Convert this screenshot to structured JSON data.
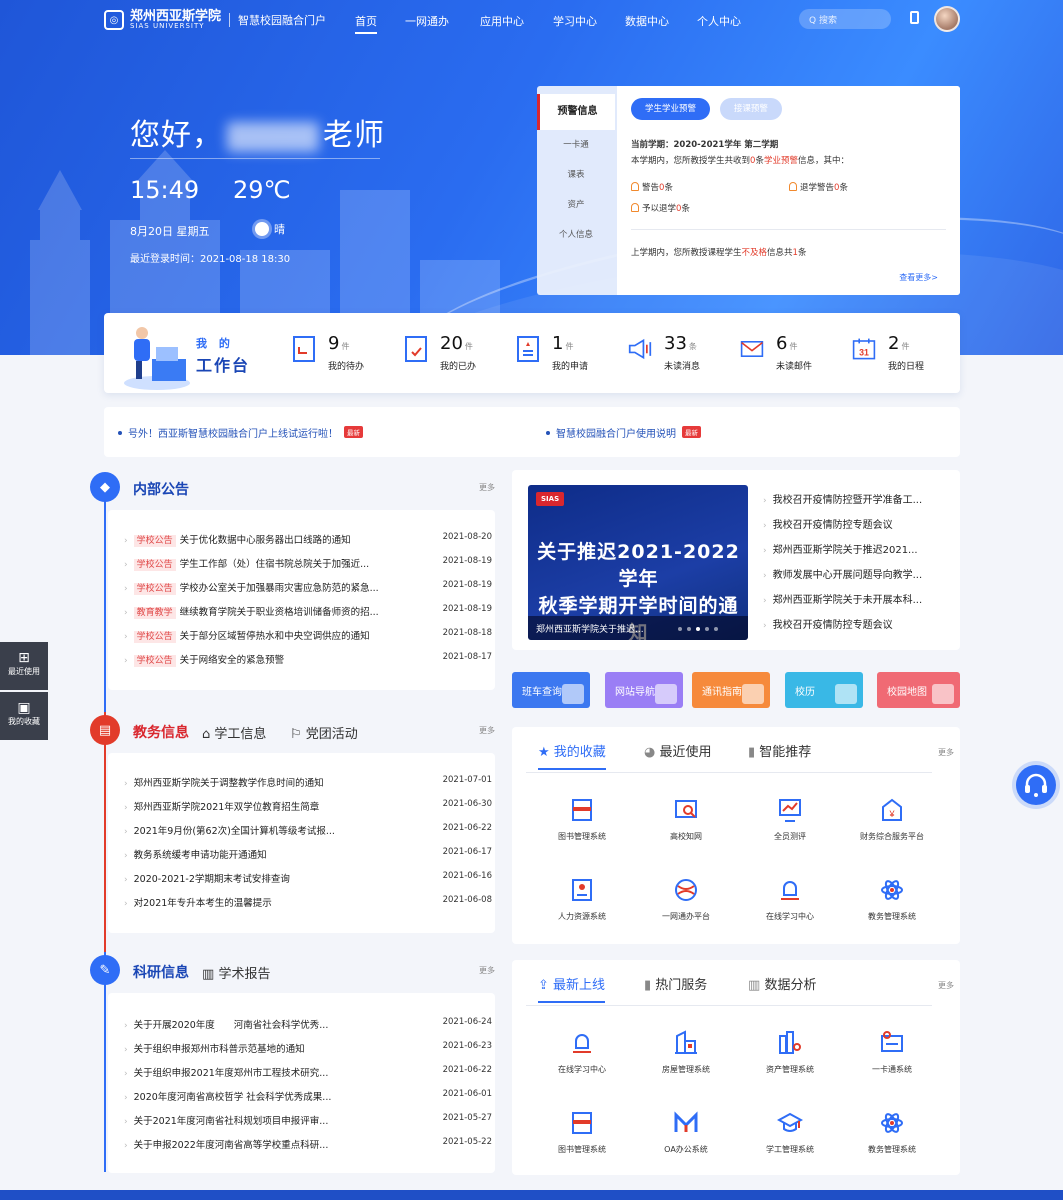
{
  "header": {
    "logo_cn": "郑州西亚斯学院",
    "logo_en": "SIAS UNIVERSITY",
    "portal_name": "智慧校园融合门户",
    "nav": [
      "首页",
      "一网通办",
      "应用中心",
      "学习中心",
      "数据中心",
      "个人中心"
    ],
    "search_placeholder": "Q 搜索"
  },
  "hero": {
    "greeting_prefix": "您好，",
    "greeting_suffix": "老师",
    "time": "15:49",
    "temperature": "29℃",
    "date": "8月20日 星期五",
    "weather": "晴",
    "last_login": "最近登录时间：2021-08-18 18:30"
  },
  "warning": {
    "side_tabs": [
      "预警信息",
      "一卡通",
      "课表",
      "资产",
      "个人信息"
    ],
    "pills": [
      "学生学业预警",
      "接课预警"
    ],
    "term_label": "当前学期：2020-2021学年 第二学期",
    "summary_a": "本学期内，您所教授学生共收到",
    "summary_count": "0",
    "summary_b": "条",
    "summary_kw": "学业预警",
    "summary_c": "信息，其中：",
    "items": [
      {
        "label": "警告",
        "count": "0",
        "unit": "条"
      },
      {
        "label": "退学警告",
        "count": "0",
        "unit": "条"
      },
      {
        "label": "予以退学",
        "count": "0",
        "unit": "条"
      }
    ],
    "last_term_a": "上学期内，您所教授课程学生",
    "last_term_kw": "不及格",
    "last_term_b": "信息共",
    "last_term_count": "1",
    "last_term_c": "条",
    "more": "查看更多>"
  },
  "workbench": {
    "label1": "我 的",
    "label2": "工作台",
    "items": [
      {
        "num": "9",
        "unit": "件",
        "label": "我的待办"
      },
      {
        "num": "20",
        "unit": "件",
        "label": "我的已办"
      },
      {
        "num": "1",
        "unit": "件",
        "label": "我的申请"
      },
      {
        "num": "33",
        "unit": "条",
        "label": "未读消息"
      },
      {
        "num": "6",
        "unit": "件",
        "label": "未读邮件"
      },
      {
        "num": "2",
        "unit": "件",
        "label": "我的日程"
      }
    ],
    "calendar_day": "31"
  },
  "ticker": [
    {
      "text": "号外！西亚斯智慧校园融合门户上线试运行啦！",
      "tag": "最新"
    },
    {
      "text": "智慧校园融合门户使用说明",
      "tag": "最新"
    }
  ],
  "notices": {
    "title": "内部公告",
    "more": "更多",
    "items": [
      {
        "tag": "学校公告",
        "title": "关于优化数据中心服务器出口线路的通知",
        "date": "2021-08-20"
      },
      {
        "tag": "学校公告",
        "title": "学生工作部（处）住宿书院总院关于加强近...",
        "date": "2021-08-19"
      },
      {
        "tag": "学校公告",
        "title": "学校办公室关于加强暴雨灾害应急防范的紧急...",
        "date": "2021-08-19"
      },
      {
        "tag": "教育教学",
        "title": "继续教育学院关于职业资格培训储备师资的招...",
        "date": "2021-08-19"
      },
      {
        "tag": "学校公告",
        "title": "关于部分区域暂停热水和中央空调供应的通知",
        "date": "2021-08-18"
      },
      {
        "tag": "学校公告",
        "title": "关于网络安全的紧急预警",
        "date": "2021-08-17"
      }
    ]
  },
  "academic": {
    "title": "教务信息",
    "tabs": [
      "学工信息",
      "党团活动"
    ],
    "more": "更多",
    "items": [
      {
        "title": "郑州西亚斯学院关于调整教学作息时间的通知",
        "date": "2021-07-01"
      },
      {
        "title": "郑州西亚斯学院2021年双学位教育招生简章",
        "date": "2021-06-30"
      },
      {
        "title": "2021年9月份(第62次)全国计算机等级考试报...",
        "date": "2021-06-22"
      },
      {
        "title": "教务系统缓考申请功能开通通知",
        "date": "2021-06-17"
      },
      {
        "title": "2020-2021-2学期期末考试安排查询",
        "date": "2021-06-16"
      },
      {
        "title": "对2021年专升本考生的温馨提示",
        "date": "2021-06-08"
      }
    ]
  },
  "research": {
    "title": "科研信息",
    "tabs": [
      "学术报告"
    ],
    "more": "更多",
    "items": [
      {
        "title": "关于开展2020年度　　河南省社会科学优秀...",
        "date": "2021-06-24"
      },
      {
        "title": "关于组织申报郑州市科普示范基地的通知",
        "date": "2021-06-23"
      },
      {
        "title": "关于组织申报2021年度郑州市工程技术研究...",
        "date": "2021-06-22"
      },
      {
        "title": "2020年度河南省高校哲学 社会科学优秀成果...",
        "date": "2021-06-01"
      },
      {
        "title": "关于2021年度河南省社科规划项目申报评审...",
        "date": "2021-05-27"
      },
      {
        "title": "关于申报2022年度河南省高等学校重点科研...",
        "date": "2021-05-22"
      }
    ]
  },
  "banner": {
    "badge": "SIAS",
    "headline1": "关于推迟2021-2022学年",
    "headline2": "秋季学期开学时间的通知",
    "caption": "郑州西亚斯学院关于推迟...",
    "side_news": [
      "我校召开疫情防控暨开学准备工...",
      "我校召开疫情防控专题会议",
      "郑州西亚斯学院关于推迟2021...",
      "教师发展中心开展问题导向教学...",
      "郑州西亚斯学院关于未开展本科...",
      "我校召开疫情防控专题会议"
    ]
  },
  "quick_tiles": [
    {
      "label": "班车查询",
      "color": "#3c78f0"
    },
    {
      "label": "网站导航",
      "color": "#9a7ef5"
    },
    {
      "label": "通讯指南",
      "color": "#f68a3c"
    },
    {
      "label": "校历",
      "color": "#39b8e6"
    },
    {
      "label": "校园地图",
      "color": "#f06a74"
    }
  ],
  "favorites": {
    "tabs": [
      "我的收藏",
      "最近使用",
      "智能推荐"
    ],
    "more": "更多",
    "apps": [
      {
        "name": "图书管理系统",
        "icon": "book-icon"
      },
      {
        "name": "高校知网",
        "icon": "search-chart-icon"
      },
      {
        "name": "全员测评",
        "icon": "chart-board-icon"
      },
      {
        "name": "财务综合服务平台",
        "icon": "finance-icon"
      },
      {
        "name": "人力资源系统",
        "icon": "hr-icon"
      },
      {
        "name": "一网通办平台",
        "icon": "globe-icon"
      },
      {
        "name": "在线学习中心",
        "icon": "bell-icon"
      },
      {
        "name": "教务管理系统",
        "icon": "atom-icon"
      }
    ]
  },
  "latest": {
    "tabs": [
      "最新上线",
      "热门服务",
      "数据分析"
    ],
    "more": "更多",
    "apps": [
      {
        "name": "在线学习中心",
        "icon": "bell-icon"
      },
      {
        "name": "房屋管理系统",
        "icon": "building-icon"
      },
      {
        "name": "资产管理系统",
        "icon": "asset-icon"
      },
      {
        "name": "一卡通系统",
        "icon": "card-icon"
      },
      {
        "name": "图书管理系统",
        "icon": "book-icon"
      },
      {
        "name": "OA办公系统",
        "icon": "m-icon"
      },
      {
        "name": "学工管理系统",
        "icon": "grad-cap-icon"
      },
      {
        "name": "教务管理系统",
        "icon": "atom-icon"
      }
    ]
  },
  "floaters": [
    "最近使用",
    "我的收藏"
  ],
  "colors": {
    "primary": "#2f6df6",
    "red": "#e23b2a",
    "orange": "#f1892d"
  }
}
